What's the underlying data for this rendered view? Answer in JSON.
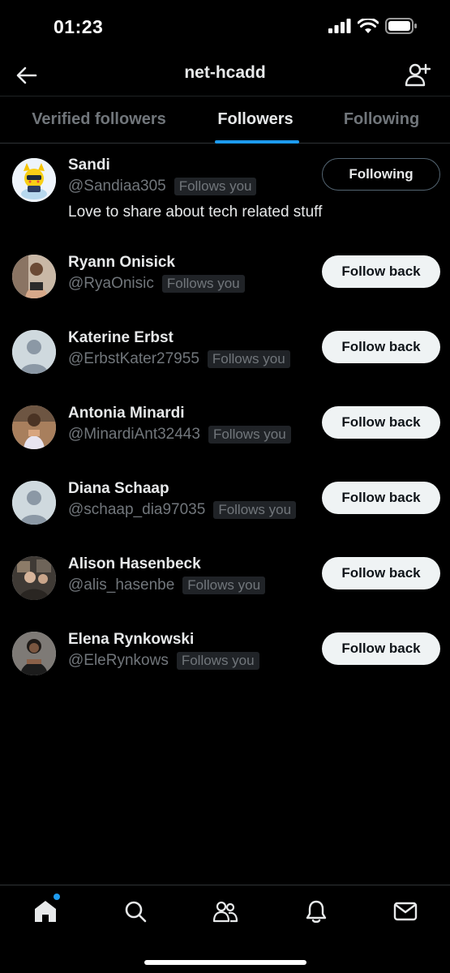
{
  "status_bar": {
    "time": "01:23"
  },
  "header": {
    "title": "net-hcadd"
  },
  "tabs": [
    {
      "label": "Verified followers"
    },
    {
      "label": "Followers"
    },
    {
      "label": "Following"
    }
  ],
  "active_tab": "Followers",
  "accent_color": "#1d9bf0",
  "users": [
    {
      "name": "Sandi",
      "handle": "@Sandiaa305",
      "badge": "Follows you",
      "bio": "Love to share about tech related stuff",
      "button": "Following"
    },
    {
      "name": "Ryann Onisick",
      "handle": "@RyaOnisic",
      "badge": "Follows you",
      "button": "Follow back"
    },
    {
      "name": "Katerine Erbst",
      "handle": "@ErbstKater27955",
      "badge": "Follows you",
      "button": "Follow back"
    },
    {
      "name": "Antonia Minardi",
      "handle": "@MinardiAnt32443",
      "badge": "Follows you",
      "button": "Follow back"
    },
    {
      "name": "Diana Schaap",
      "handle": "@schaap_dia97035",
      "badge": "Follows you",
      "button": "Follow back"
    },
    {
      "name": "Alison Hasenbeck",
      "handle": "@alis_hasenbe",
      "badge": "Follows you",
      "button": "Follow back"
    },
    {
      "name": "Elena Rynkowski",
      "handle": "@EleRynkows",
      "badge": "Follows you",
      "button": "Follow back"
    }
  ],
  "bottom_nav": [
    {
      "icon": "home-icon",
      "has_notification_dot": true
    },
    {
      "icon": "search-icon"
    },
    {
      "icon": "communities-icon"
    },
    {
      "icon": "notifications-icon"
    },
    {
      "icon": "messages-icon"
    }
  ]
}
